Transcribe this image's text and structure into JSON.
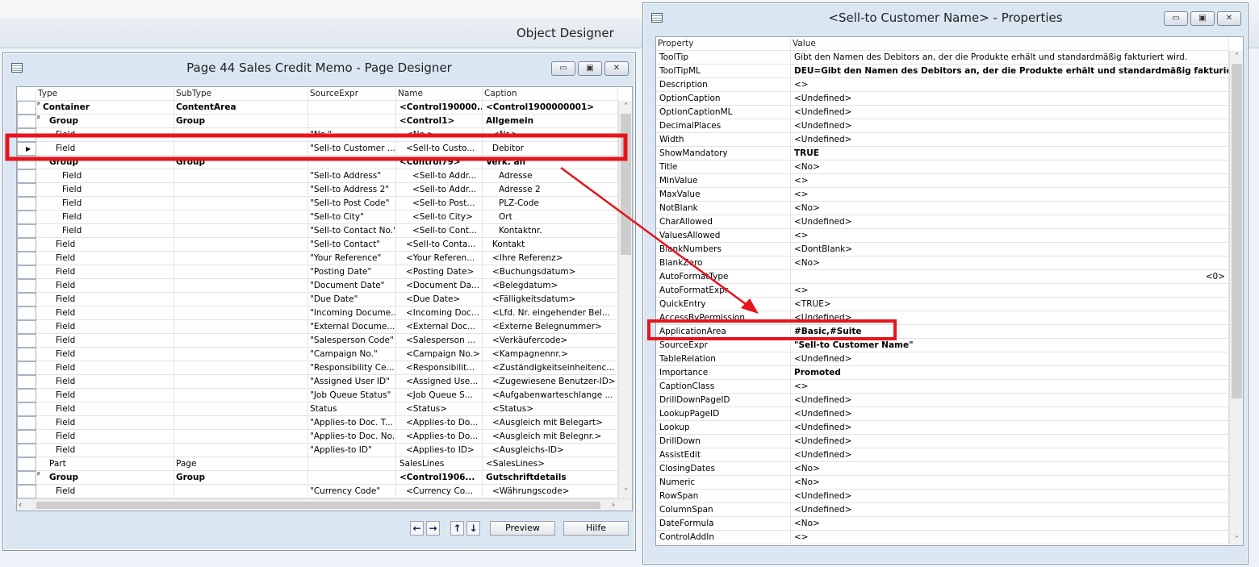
{
  "object_designer": {
    "title": "Object Designer"
  },
  "page_designer": {
    "title": "Page 44 Sales Credit Memo - Page Designer",
    "columns": [
      "Type",
      "SubType",
      "SourceExpr",
      "Name",
      "Caption"
    ],
    "rows": [
      {
        "type": "Container",
        "subtype": "ContentArea",
        "source": "",
        "name": "<Control190000...",
        "caption": "<Control1900000001>",
        "bold": true,
        "indent": 0,
        "expander": true
      },
      {
        "type": "Group",
        "subtype": "Group",
        "source": "",
        "name": "<Control1>",
        "caption": "Allgemein",
        "bold": true,
        "indent": 1,
        "expander": true
      },
      {
        "type": "Field",
        "subtype": "",
        "source": "\"No.\"",
        "name": "<No.>",
        "caption": "<Nr.>",
        "indent": 2
      },
      {
        "type": "Field",
        "subtype": "",
        "source": "\"Sell-to Customer ...",
        "name": "<Sell-to Custo...",
        "caption": "Debitor",
        "indent": 2,
        "selected": true
      },
      {
        "type": "Group",
        "subtype": "Group",
        "source": "",
        "name": "<Control79>",
        "caption": "Verk. an",
        "bold": true,
        "indent": 1,
        "expander": true
      },
      {
        "type": "Field",
        "subtype": "",
        "source": "\"Sell-to Address\"",
        "name": "<Sell-to Addr...",
        "caption": "Adresse",
        "indent": 3
      },
      {
        "type": "Field",
        "subtype": "",
        "source": "\"Sell-to Address 2\"",
        "name": "<Sell-to Addr...",
        "caption": "Adresse 2",
        "indent": 3
      },
      {
        "type": "Field",
        "subtype": "",
        "source": "\"Sell-to Post Code\"",
        "name": "<Sell-to Post...",
        "caption": "PLZ-Code",
        "indent": 3
      },
      {
        "type": "Field",
        "subtype": "",
        "source": "\"Sell-to City\"",
        "name": "<Sell-to City>",
        "caption": "Ort",
        "indent": 3
      },
      {
        "type": "Field",
        "subtype": "",
        "source": "\"Sell-to Contact No.\"",
        "name": "<Sell-to Cont...",
        "caption": "Kontaktnr.",
        "indent": 3
      },
      {
        "type": "Field",
        "subtype": "",
        "source": "\"Sell-to Contact\"",
        "name": "<Sell-to Conta...",
        "caption": "Kontakt",
        "indent": 2
      },
      {
        "type": "Field",
        "subtype": "",
        "source": "\"Your Reference\"",
        "name": "<Your Referen...",
        "caption": "<Ihre Referenz>",
        "indent": 2
      },
      {
        "type": "Field",
        "subtype": "",
        "source": "\"Posting Date\"",
        "name": "<Posting Date>",
        "caption": "<Buchungsdatum>",
        "indent": 2
      },
      {
        "type": "Field",
        "subtype": "",
        "source": "\"Document Date\"",
        "name": "<Document Da...",
        "caption": "<Belegdatum>",
        "indent": 2
      },
      {
        "type": "Field",
        "subtype": "",
        "source": "\"Due Date\"",
        "name": "<Due Date>",
        "caption": "<Fälligkeitsdatum>",
        "indent": 2
      },
      {
        "type": "Field",
        "subtype": "",
        "source": "\"Incoming Docume...",
        "name": "<Incoming Doc...",
        "caption": "<Lfd. Nr. eingehender Bel...",
        "indent": 2
      },
      {
        "type": "Field",
        "subtype": "",
        "source": "\"External Docume...",
        "name": "<External Doc...",
        "caption": "<Externe Belegnummer>",
        "indent": 2
      },
      {
        "type": "Field",
        "subtype": "",
        "source": "\"Salesperson Code\"",
        "name": "<Salesperson ...",
        "caption": "<Verkäufercode>",
        "indent": 2
      },
      {
        "type": "Field",
        "subtype": "",
        "source": "\"Campaign No.\"",
        "name": "<Campaign No.>",
        "caption": "<Kampagnennr.>",
        "indent": 2
      },
      {
        "type": "Field",
        "subtype": "",
        "source": "\"Responsibility Ce...",
        "name": "<Responsibilit...",
        "caption": "<Zuständigkeitseinheitenc...",
        "indent": 2
      },
      {
        "type": "Field",
        "subtype": "",
        "source": "\"Assigned User ID\"",
        "name": "<Assigned Use...",
        "caption": "<Zugewiesene Benutzer-ID>",
        "indent": 2
      },
      {
        "type": "Field",
        "subtype": "",
        "source": "\"Job Queue Status\"",
        "name": "<Job Queue S...",
        "caption": "<Aufgabenwarteschlange ...",
        "indent": 2
      },
      {
        "type": "Field",
        "subtype": "",
        "source": "Status",
        "name": "<Status>",
        "caption": "<Status>",
        "indent": 2
      },
      {
        "type": "Field",
        "subtype": "",
        "source": "\"Applies-to Doc. T...",
        "name": "<Applies-to Do...",
        "caption": "<Ausgleich mit Belegart>",
        "indent": 2
      },
      {
        "type": "Field",
        "subtype": "",
        "source": "\"Applies-to Doc. No.\"",
        "name": "<Applies-to Do...",
        "caption": "<Ausgleich mit Belegnr.>",
        "indent": 2
      },
      {
        "type": "Field",
        "subtype": "",
        "source": "\"Applies-to ID\"",
        "name": "<Applies-to ID>",
        "caption": "<Ausgleichs-ID>",
        "indent": 2
      },
      {
        "type": "Part",
        "subtype": "Page",
        "source": "",
        "name": "SalesLines",
        "caption": "<SalesLines>",
        "indent": 1
      },
      {
        "type": "Group",
        "subtype": "Group",
        "source": "",
        "name": "<Control1906...",
        "caption": "Gutschriftdetails",
        "bold": true,
        "indent": 1,
        "expander": true
      },
      {
        "type": "Field",
        "subtype": "",
        "source": "\"Currency Code\"",
        "name": "<Currency Co...",
        "caption": "<Währungscode>",
        "indent": 2
      }
    ],
    "buttons": {
      "preview": "Preview",
      "help": "Hilfe"
    }
  },
  "properties": {
    "title": "<Sell-to Customer Name> - Properties",
    "columns": [
      "Property",
      "Value"
    ],
    "rows": [
      {
        "p": "ToolTip",
        "v": "Gibt den Namen des Debitors an, der die Produkte erhält und standardmäßig fakturiert wird."
      },
      {
        "p": "ToolTipML",
        "v": "DEU=Gibt den Namen des Debitors an, der die Produkte erhält und standardmäßig fakturiert ...",
        "bold": true
      },
      {
        "p": "Description",
        "v": "<>"
      },
      {
        "p": "OptionCaption",
        "v": "<Undefined>"
      },
      {
        "p": "OptionCaptionML",
        "v": "<Undefined>"
      },
      {
        "p": "DecimalPlaces",
        "v": "<Undefined>"
      },
      {
        "p": "Width",
        "v": "<Undefined>"
      },
      {
        "p": "ShowMandatory",
        "v": "TRUE",
        "bold": true
      },
      {
        "p": "Title",
        "v": "<No>"
      },
      {
        "p": "MinValue",
        "v": "<>"
      },
      {
        "p": "MaxValue",
        "v": "<>"
      },
      {
        "p": "NotBlank",
        "v": "<No>"
      },
      {
        "p": "CharAllowed",
        "v": "<Undefined>"
      },
      {
        "p": "ValuesAllowed",
        "v": "<>"
      },
      {
        "p": "BlankNumbers",
        "v": "<DontBlank>"
      },
      {
        "p": "BlankZero",
        "v": "<No>"
      },
      {
        "p": "AutoFormatType",
        "v": "<0>",
        "right": true
      },
      {
        "p": "AutoFormatExpr",
        "v": "<>"
      },
      {
        "p": "QuickEntry",
        "v": "<TRUE>"
      },
      {
        "p": "AccessByPermission",
        "v": "<Undefined>"
      },
      {
        "p": "ApplicationArea",
        "v": "#Basic,#Suite",
        "bold": true
      },
      {
        "p": "SourceExpr",
        "v": "\"Sell-to Customer Name\"",
        "bold": true
      },
      {
        "p": "TableRelation",
        "v": "<Undefined>"
      },
      {
        "p": "Importance",
        "v": "Promoted",
        "bold": true
      },
      {
        "p": "CaptionClass",
        "v": "<>"
      },
      {
        "p": "DrillDownPageID",
        "v": "<Undefined>"
      },
      {
        "p": "LookupPageID",
        "v": "<Undefined>"
      },
      {
        "p": "Lookup",
        "v": "<Undefined>"
      },
      {
        "p": "DrillDown",
        "v": "<Undefined>"
      },
      {
        "p": "AssistEdit",
        "v": "<Undefined>"
      },
      {
        "p": "ClosingDates",
        "v": "<No>"
      },
      {
        "p": "Numeric",
        "v": "<No>"
      },
      {
        "p": "RowSpan",
        "v": "<Undefined>"
      },
      {
        "p": "ColumnSpan",
        "v": "<Undefined>"
      },
      {
        "p": "DateFormula",
        "v": "<No>"
      },
      {
        "p": "ControlAddIn",
        "v": "<>"
      }
    ]
  },
  "annotation_color": "#e8141c"
}
